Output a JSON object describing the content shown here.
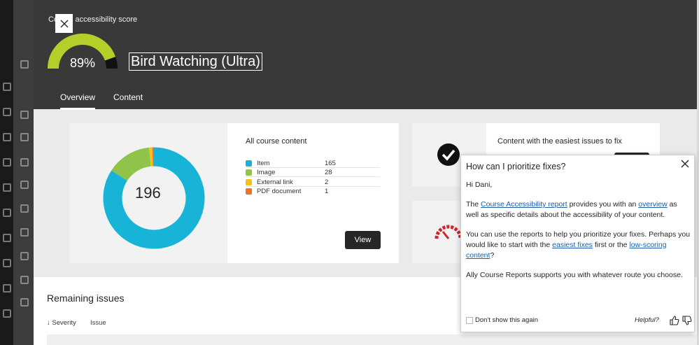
{
  "header": {
    "score_label": "Course accessibility score",
    "score_pct": "89%",
    "score_value": 89,
    "course_title": "Bird Watching (Ultra)",
    "tabs": [
      {
        "label": "Overview",
        "active": true
      },
      {
        "label": "Content",
        "active": false
      }
    ]
  },
  "overview": {
    "total": "196",
    "section_title": "All course content",
    "legend": [
      {
        "label": "Item",
        "count": "165",
        "color": "#17b4d8"
      },
      {
        "label": "Image",
        "count": "28",
        "color": "#8fc34a"
      },
      {
        "label": "External link",
        "count": "2",
        "color": "#f3c21a"
      },
      {
        "label": "PDF document",
        "count": "1",
        "color": "#f07325"
      }
    ],
    "view_label": "View"
  },
  "easiest": {
    "title": "Content with the easiest issues to fix"
  },
  "remaining": {
    "title": "Remaining issues",
    "sort_severity": "Severity",
    "sort_issue": "Issue"
  },
  "popover": {
    "title": "How can I prioritize fixes?",
    "greeting": "Hi Dani,",
    "p1_pre": "The ",
    "p1_link1": "Course Accessibility report",
    "p1_mid": " provides you with an ",
    "p1_link2": "overview",
    "p1_post": " as well as specific details about the accessibility of your content.",
    "p2_pre": "You can use the reports to help you prioritize your fixes. Perhaps you would like to start with the ",
    "p2_link1": "easiest fixes",
    "p2_mid": " first or the ",
    "p2_link2": "low-scoring content",
    "p2_post": "?",
    "p3": "Ally Course Reports supports you with whatever route you choose.",
    "dont_show": "Don't show this again",
    "helpful": "Helpful?"
  },
  "colors": {
    "gauge_fill": "#b4cf2a",
    "gauge_rest": "#111111",
    "header_bg": "#393939",
    "link": "#1a5ea8",
    "gauge_red": "#d2232a"
  },
  "icons": [
    "close-icon",
    "checkmark-circle-icon",
    "speedometer-icon",
    "thumbs-up-icon",
    "thumbs-down-icon",
    "arrow-down-icon"
  ]
}
